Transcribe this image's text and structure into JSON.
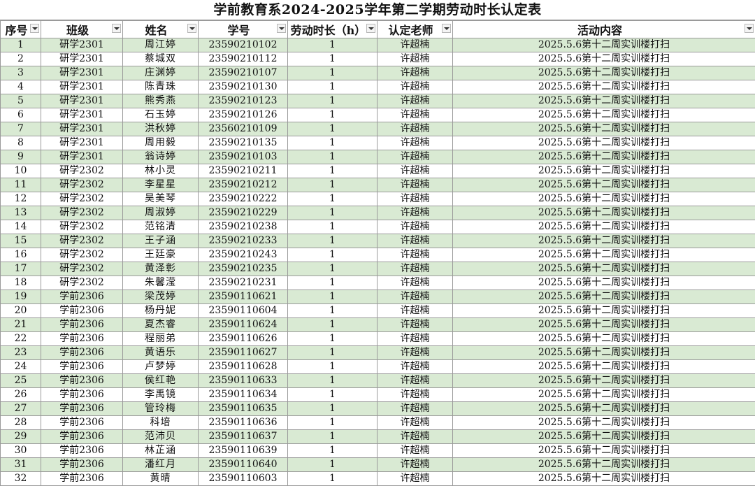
{
  "title": "学前教育系2024-2025学年第二学期劳动时长认定表",
  "headers": [
    "序号",
    "班级",
    "姓名",
    "学号",
    "劳动时长（h）",
    "认定老师",
    "活动内容"
  ],
  "rows": [
    [
      "1",
      "研学2301",
      "周江婷",
      "23590210102",
      "1",
      "许超楠",
      "2025.5.6第十二周实训楼打扫"
    ],
    [
      "2",
      "研学2301",
      "蔡城双",
      "23590210112",
      "1",
      "许超楠",
      "2025.5.6第十二周实训楼打扫"
    ],
    [
      "3",
      "研学2301",
      "庄渊婷",
      "23590210107",
      "1",
      "许超楠",
      "2025.5.6第十二周实训楼打扫"
    ],
    [
      "4",
      "研学2301",
      "陈青珠",
      "23590210130",
      "1",
      "许超楠",
      "2025.5.6第十二周实训楼打扫"
    ],
    [
      "5",
      "研学2301",
      "熊秀燕",
      "23590210123",
      "1",
      "许超楠",
      "2025.5.6第十二周实训楼打扫"
    ],
    [
      "6",
      "研学2301",
      "石玉婷",
      "23590210126",
      "1",
      "许超楠",
      "2025.5.6第十二周实训楼打扫"
    ],
    [
      "7",
      "研学2301",
      "洪秋婷",
      "23560210109",
      "1",
      "许超楠",
      "2025.5.6第十二周实训楼打扫"
    ],
    [
      "8",
      "研学2301",
      "周用毅",
      "23590210135",
      "1",
      "许超楠",
      "2025.5.6第十二周实训楼打扫"
    ],
    [
      "9",
      "研学2301",
      "翁诗婷",
      "23590210103",
      "1",
      "许超楠",
      "2025.5.6第十二周实训楼打扫"
    ],
    [
      "10",
      "研学2302",
      "林小灵",
      "23590210211",
      "1",
      "许超楠",
      "2025.5.6第十二周实训楼打扫"
    ],
    [
      "11",
      "研学2302",
      "李星星",
      "23590210212",
      "1",
      "许超楠",
      "2025.5.6第十二周实训楼打扫"
    ],
    [
      "12",
      "研学2302",
      "吴美琴",
      "23590210222",
      "1",
      "许超楠",
      "2025.5.6第十二周实训楼打扫"
    ],
    [
      "13",
      "研学2302",
      "周淑婷",
      "23590210229",
      "1",
      "许超楠",
      "2025.5.6第十二周实训楼打扫"
    ],
    [
      "14",
      "研学2302",
      "范铭清",
      "23590210238",
      "1",
      "许超楠",
      "2025.5.6第十二周实训楼打扫"
    ],
    [
      "15",
      "研学2302",
      "王子涵",
      "23590210233",
      "1",
      "许超楠",
      "2025.5.6第十二周实训楼打扫"
    ],
    [
      "16",
      "研学2302",
      "王廷豪",
      "23590210243",
      "1",
      "许超楠",
      "2025.5.6第十二周实训楼打扫"
    ],
    [
      "17",
      "研学2302",
      "黄泽彰",
      "23590210235",
      "1",
      "许超楠",
      "2025.5.6第十二周实训楼打扫"
    ],
    [
      "18",
      "研学2302",
      "朱馨滢",
      "23590210231",
      "1",
      "许超楠",
      "2025.5.6第十二周实训楼打扫"
    ],
    [
      "19",
      "学前2306",
      "梁茂婷",
      "23590110621",
      "1",
      "许超楠",
      "2025.5.6第十二周实训楼打扫"
    ],
    [
      "20",
      "学前2306",
      "杨丹妮",
      "23590110604",
      "1",
      "许超楠",
      "2025.5.6第十二周实训楼打扫"
    ],
    [
      "21",
      "学前2306",
      "夏杰睿",
      "23590110624",
      "1",
      "许超楠",
      "2025.5.6第十二周实训楼打扫"
    ],
    [
      "22",
      "学前2306",
      "程丽弟",
      "23590110626",
      "1",
      "许超楠",
      "2025.5.6第十二周实训楼打扫"
    ],
    [
      "23",
      "学前2306",
      "黄语乐",
      "23590110627",
      "1",
      "许超楠",
      "2025.5.6第十二周实训楼打扫"
    ],
    [
      "24",
      "学前2306",
      "卢梦婷",
      "23590110628",
      "1",
      "许超楠",
      "2025.5.6第十二周实训楼打扫"
    ],
    [
      "25",
      "学前2306",
      "侯红艳",
      "23590110633",
      "1",
      "许超楠",
      "2025.5.6第十二周实训楼打扫"
    ],
    [
      "26",
      "学前2306",
      "李禹镜",
      "23590110634",
      "1",
      "许超楠",
      "2025.5.6第十二周实训楼打扫"
    ],
    [
      "27",
      "学前2306",
      "管玲梅",
      "23590110635",
      "1",
      "许超楠",
      "2025.5.6第十二周实训楼打扫"
    ],
    [
      "28",
      "学前2306",
      "科培",
      "23590110636",
      "1",
      "许超楠",
      "2025.5.6第十二周实训楼打扫"
    ],
    [
      "29",
      "学前2306",
      "范沛贝",
      "23590110637",
      "1",
      "许超楠",
      "2025.5.6第十二周实训楼打扫"
    ],
    [
      "30",
      "学前2306",
      "林芷涵",
      "23590110639",
      "1",
      "许超楠",
      "2025.5.6第十二周实训楼打扫"
    ],
    [
      "31",
      "学前2306",
      "潘红月",
      "23590110640",
      "1",
      "许超楠",
      "2025.5.6第十二周实训楼打扫"
    ],
    [
      "32",
      "学前2306",
      "黄晴",
      "23590110603",
      "1",
      "许超楠",
      "2025.5.6第十二周实训楼打扫"
    ]
  ],
  "colors": {
    "stripe": "#d9ead3",
    "grid": "#9a9a9a"
  },
  "icons": {
    "filter": "dropdown-filter-icon"
  }
}
